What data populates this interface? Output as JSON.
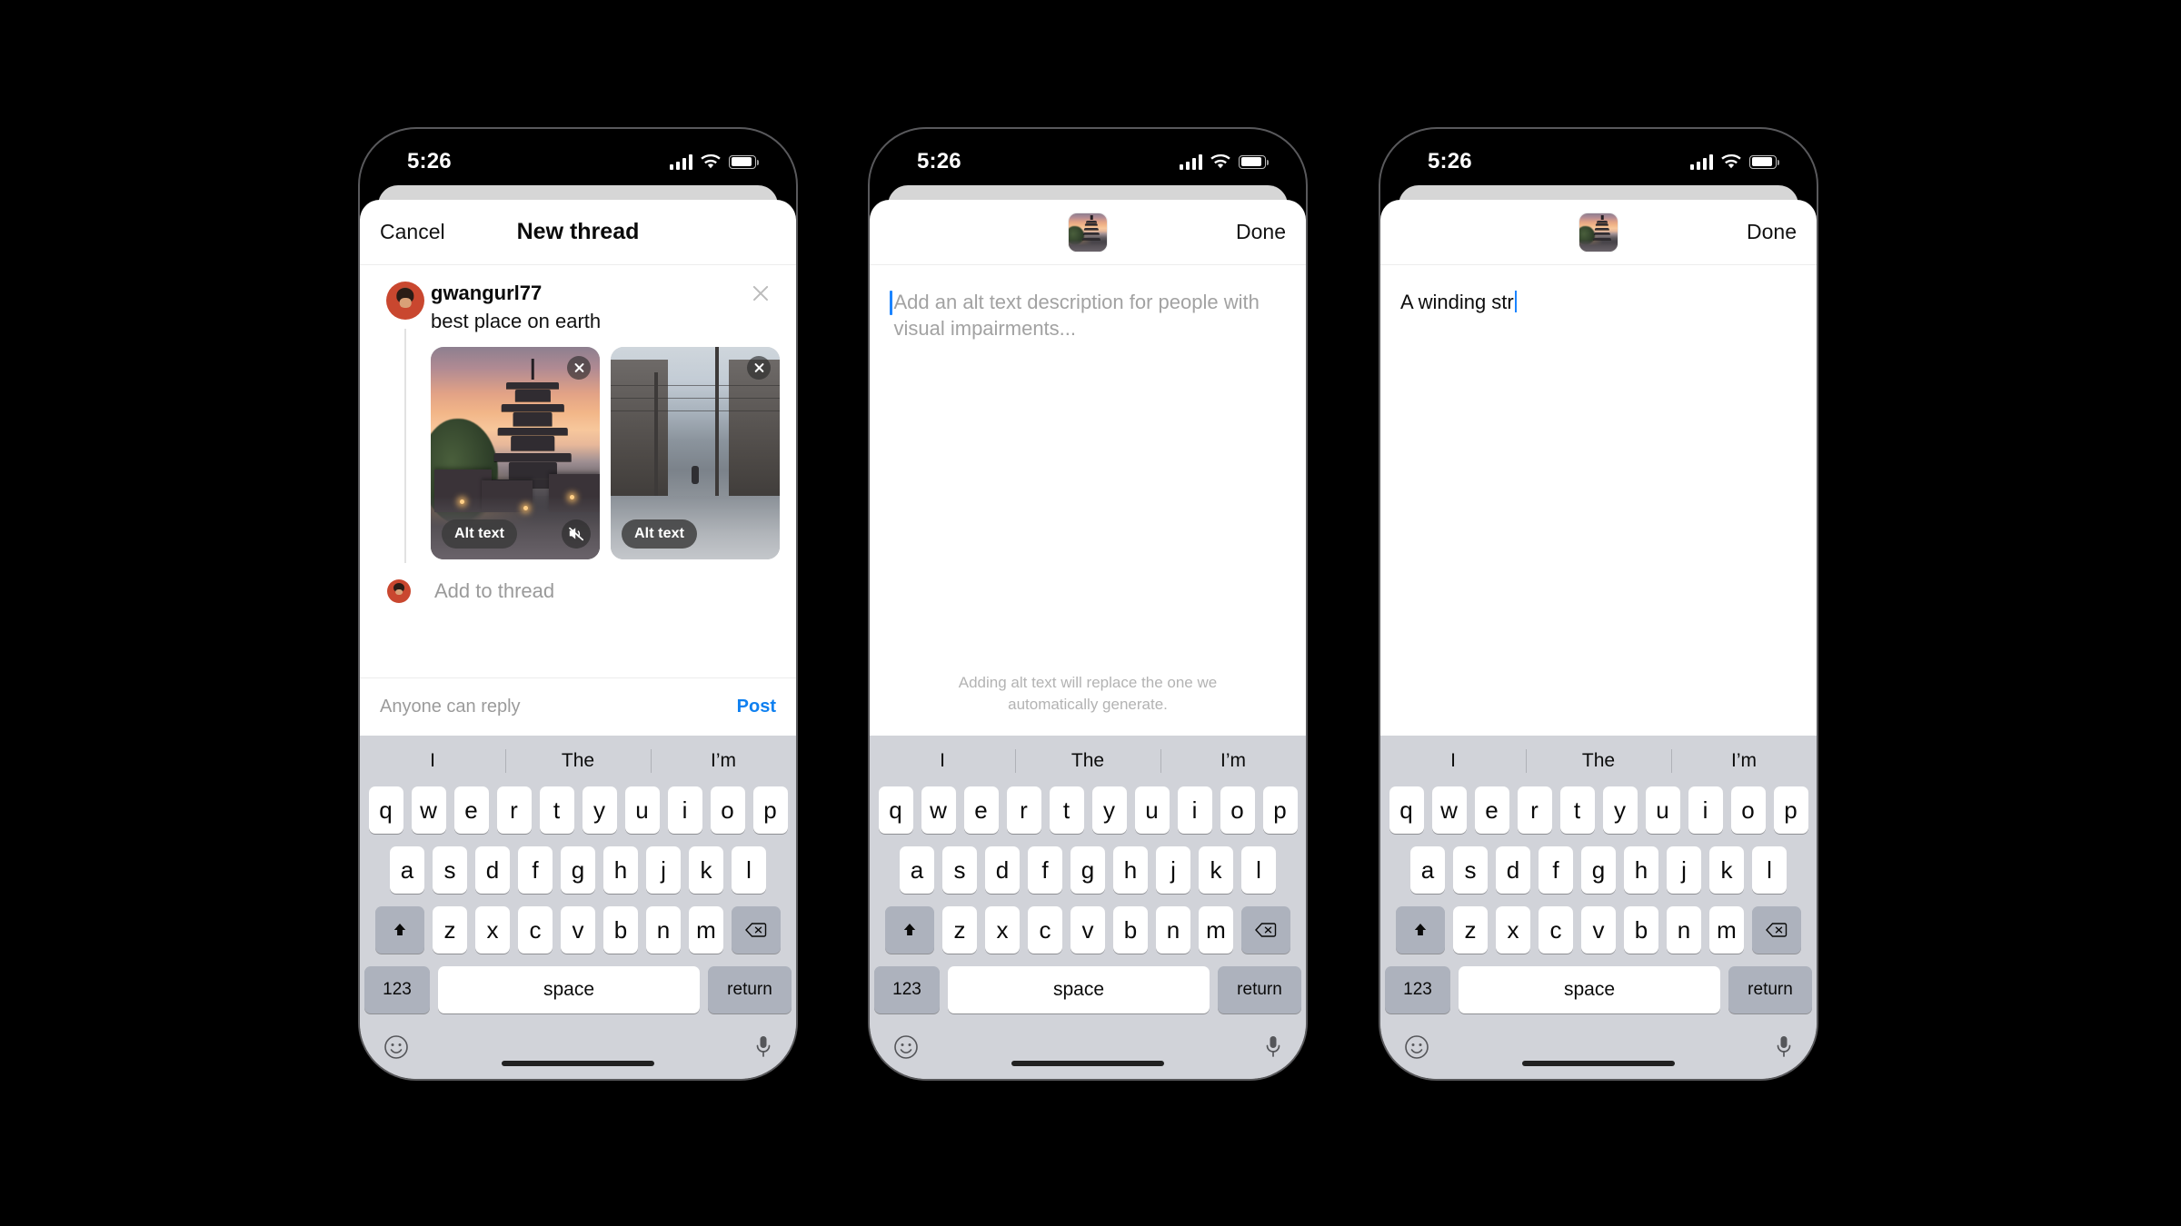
{
  "meta": {
    "app": "Threads",
    "screen_count": 3
  },
  "status_bar": {
    "time": "5:26",
    "signal_icon": "cellular-signal-icon",
    "wifi_icon": "wifi-icon",
    "battery_icon": "battery-icon"
  },
  "screen1": {
    "nav": {
      "cancel_label": "Cancel",
      "title": "New thread"
    },
    "post": {
      "username": "gwangurl77",
      "caption": "best place on earth",
      "avatar_name": "user-avatar",
      "close_icon": "close-icon"
    },
    "media": [
      {
        "alt_badge": "Alt text",
        "name": "media-thumb-pagoda",
        "has_mute": true,
        "mute_icon": "mute-icon",
        "remove_icon": "remove-media-icon"
      },
      {
        "alt_badge": "Alt text",
        "name": "media-thumb-alley",
        "has_mute": false,
        "remove_icon": "remove-media-icon"
      },
      {
        "alt_badge": "",
        "name": "media-thumb-partial",
        "has_mute": false,
        "remove_icon": ""
      }
    ],
    "add_to_thread": {
      "label": "Add to thread",
      "avatar_name": "user-avatar-small"
    },
    "footer": {
      "reply_policy": "Anyone can reply",
      "post_label": "Post",
      "post_color": "#0f80f0"
    }
  },
  "screen2": {
    "nav": {
      "thumb_name": "selected-media-thumbnail",
      "done_label": "Done"
    },
    "alt_input": {
      "placeholder": "Add an alt text description for people with visual impairments...",
      "value": "",
      "caret_color": "#1b84ff"
    },
    "hint": "Adding alt text will replace the one we automatically generate."
  },
  "screen3": {
    "nav": {
      "thumb_name": "selected-media-thumbnail",
      "done_label": "Done"
    },
    "alt_input": {
      "placeholder": "Add an alt text description for people with visual impairments...",
      "value": "A winding str",
      "caret_color": "#1b84ff"
    },
    "hint": ""
  },
  "keyboard": {
    "predictions": [
      "I",
      "The",
      "I’m"
    ],
    "row1": [
      "q",
      "w",
      "e",
      "r",
      "t",
      "y",
      "u",
      "i",
      "o",
      "p"
    ],
    "row2": [
      "a",
      "s",
      "d",
      "f",
      "g",
      "h",
      "j",
      "k",
      "l"
    ],
    "row3": [
      "z",
      "x",
      "c",
      "v",
      "b",
      "n",
      "m"
    ],
    "shift_icon": "shift-icon",
    "backspace_icon": "backspace-icon",
    "num_label": "123",
    "space_label": "space",
    "return_label": "return",
    "emoji_icon": "emoji-icon",
    "mic_icon": "microphone-icon",
    "home_indicator": "home-indicator"
  }
}
